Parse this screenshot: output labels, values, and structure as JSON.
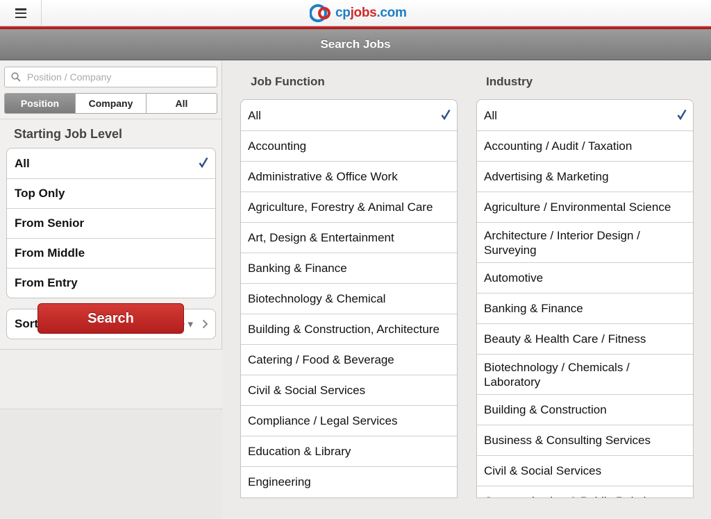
{
  "header": {
    "logo": {
      "cp": "cp",
      "jobs": "jobs",
      "com": ".com"
    },
    "title": "Search Jobs"
  },
  "search": {
    "placeholder": "Position / Company",
    "value": "",
    "scopes": [
      "Position",
      "Company",
      "All"
    ],
    "selected_scope": "Position"
  },
  "job_level": {
    "title": "Starting Job Level",
    "options": [
      "All",
      "Top Only",
      "From Senior",
      "From Middle",
      "From Entry"
    ],
    "selected": "All"
  },
  "sort": {
    "label": "Sort Order",
    "value": "Post date ▾"
  },
  "search_button": "Search",
  "job_function": {
    "title": "Job Function",
    "items": [
      "All",
      "Accounting",
      "Administrative & Office Work",
      "Agriculture, Forestry & Animal Care",
      "Art, Design & Entertainment",
      "Banking & Finance",
      "Biotechnology & Chemical",
      "Building & Construction, Architecture",
      "Catering / Food & Beverage",
      "Civil & Social Services",
      "Compliance / Legal Services",
      "Education & Library",
      "Engineering"
    ],
    "selected": "All"
  },
  "industry": {
    "title": "Industry",
    "items": [
      "All",
      "Accounting / Audit / Taxation",
      "Advertising & Marketing",
      "Agriculture / Environmental Science",
      "Architecture / Interior Design / Surveying",
      "Automotive",
      "Banking & Finance",
      "Beauty & Health Care / Fitness",
      "Biotechnology / Chemicals / Laboratory",
      "Building & Construction",
      "Business & Consulting Services",
      "Civil & Social Services",
      "Communication & Public Relations"
    ],
    "selected": "All"
  },
  "colors": {
    "accent_red": "#c62222",
    "check_blue": "#2b4f8a",
    "brand_blue": "#1c7fc6"
  }
}
